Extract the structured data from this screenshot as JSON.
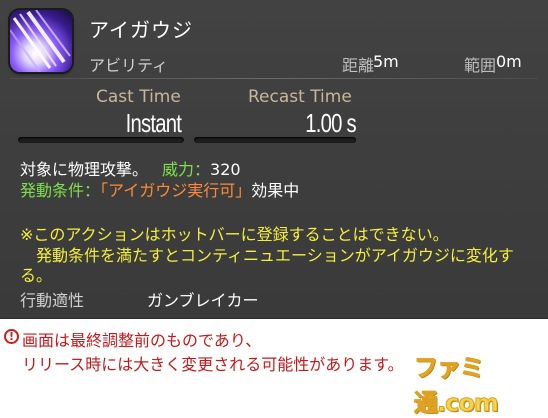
{
  "action": {
    "name": "アイガウジ",
    "type": "アビリティ",
    "distance_label": "距離",
    "distance_value": "5m",
    "range_label": "範囲",
    "range_value": "0m",
    "icon": "slash-icon"
  },
  "timing": {
    "cast_label": "Cast Time",
    "cast_value": "Instant",
    "recast_label": "Recast Time",
    "recast_value": "1.00 s"
  },
  "description": {
    "line1": "対象に物理攻撃。",
    "potency_label": "威力：",
    "potency_value": "320",
    "condition_label": "発動条件：",
    "condition_value": "「アイガウジ実行可」",
    "condition_suffix": "効果中",
    "note1": "※このアクションはホットバーに登録することはできない。",
    "note2": "　発動条件を満たすとコンティニュエーションがアイガウジに変化す",
    "note3": "る。",
    "job_label": "行動適性",
    "job_value": "ガンブレイカー"
  },
  "footer": {
    "warning_icon": "!",
    "note_line1": "画面は最終調整前のものであり、",
    "note_line2": "リリース時には大きく変更される可能性があります。",
    "watermark": "ファミ通.com"
  },
  "colors": {
    "panel": "#3d3d3d",
    "label_tan": "#c9b69a",
    "green": "#7ee04a",
    "orange": "#ff8a3a",
    "yellow": "#f6ef3a",
    "footer_red": "#c8181c"
  }
}
